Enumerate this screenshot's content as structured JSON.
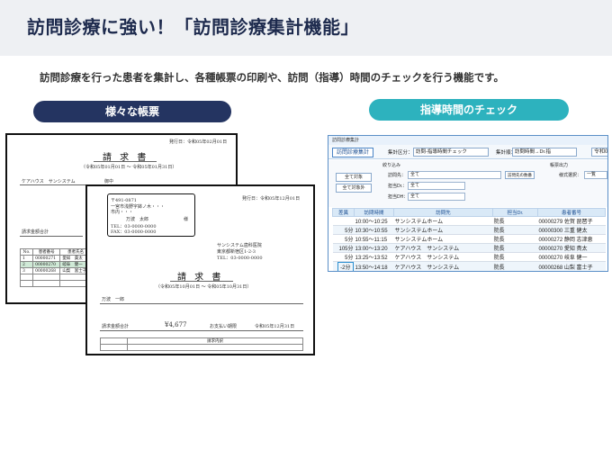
{
  "hero": {
    "title": "訪問診療に強い！「訪問診療集計機能」"
  },
  "description": "訪問診療を行った患者を集計し、各種帳票の印刷や、訪問（指導）時間のチェックを行う機能です。",
  "pills": {
    "left": "様々な帳票",
    "right": "指導時間のチェック"
  },
  "colors": {
    "navy": "#243461",
    "teal": "#2db2be",
    "hero_bg": "#eef0f3"
  },
  "invoice_back": {
    "issue_date": "発行日：令和05年02月01日",
    "title": "請 求 書",
    "period": "（令和05年01月01日 ～ 令和05年01月31日）",
    "recipient": "ケアハウス　サンシステム",
    "honorific": "御中",
    "section": "請求金額合計",
    "table_headers": [
      "No.",
      "患者番号",
      "患者氏名"
    ],
    "rows": [
      [
        "1",
        "00000271",
        "愛知　貴太"
      ],
      [
        "2",
        "00000270",
        "岐阜　健一"
      ],
      [
        "3",
        "00000268",
        "山梨　富士子"
      ]
    ]
  },
  "invoice_front": {
    "issue_date": "発行日：令和05年12月01日",
    "postal": "〒491-0871",
    "address": "一宮市浅野字鉢ノ木・・・",
    "address2": "市内・・・",
    "patient": "万波　太郎",
    "sama": "様",
    "tel": "TEL：03-0000-0000",
    "fax": "FAX：03-0000-0000",
    "clinic_name": "サンシステム歯科医院",
    "clinic_addr": "東京都新宿区1-2-3",
    "clinic_addr2": "TEL：03-0000-0000",
    "title": "請 求 書",
    "period": "（令和05年10月01日 ～ 令和05年10月31日）",
    "subtitle": "万波　一郎",
    "amount_label": "請求金額合計",
    "amount": "¥4,677",
    "footer_note": "お支払い期限",
    "footer_date": "令和05年12月31日",
    "table_head": "請求内訳"
  },
  "app": {
    "window_title": "訪問診療集計",
    "toolbar_title": "訪問診療集計",
    "aggregation_label": "集計区分：",
    "aggregation_value": "訪問-指導時間チェック",
    "unit_label": "集計順：",
    "unit_value": "訪問時間→Dr.指",
    "year_short": "令和0",
    "filter": {
      "section_label": "絞り込み",
      "btn_all_select": "全て対象",
      "btn_all_clear": "全て対象外",
      "visit_label": "訪問先：",
      "visit_value": "全て",
      "dept_label": "担当Dr.：",
      "dept_value": "全て",
      "dh_label": "担当DH：",
      "dh_value": "全て",
      "extra_btn": "訪問先の数番",
      "ledger_label": "帳票出力",
      "format_label": "様式選択：",
      "format_value": "一覧"
    },
    "grid_headers": [
      "差異",
      "訪問時間",
      "訪問先",
      "担当Dr.",
      "患者番号"
    ],
    "rows": [
      {
        "diff": "",
        "time": "10:00〜10:25",
        "place": "サンシステムホーム",
        "dr": "院長",
        "patient": "00000279 佐賀 琵琶子"
      },
      {
        "diff": "5分",
        "time": "10:30〜10:55",
        "place": "サンシステムホーム",
        "dr": "院長",
        "patient": "00000300 三重 健太"
      },
      {
        "diff": "5分",
        "time": "10:55〜11:15",
        "place": "サンシステムホーム",
        "dr": "院長",
        "patient": "00000272 静岡 志津恵"
      },
      {
        "diff": "105分",
        "time": "13:00〜13:20",
        "place": "ケアハウス　サンシステム",
        "dr": "院長",
        "patient": "00000270 愛知 貴太"
      },
      {
        "diff": "5分",
        "time": "13:25〜13:52",
        "place": "ケアハウス　サンシステム",
        "dr": "院長",
        "patient": "00000270 岐阜 健一"
      },
      {
        "diff": "-2分",
        "time": "13:50〜14:18",
        "place": "ケアハウス　サンシステム",
        "dr": "院長",
        "patient": "00000268 山梨 富士子"
      }
    ]
  }
}
